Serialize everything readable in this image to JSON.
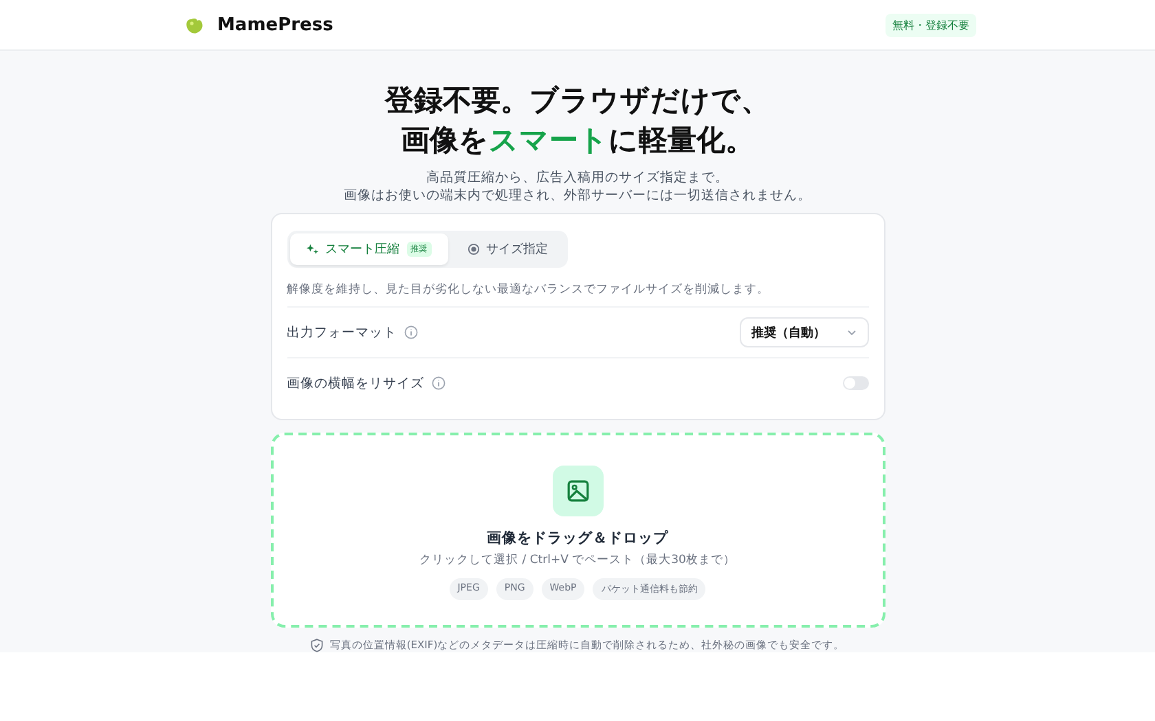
{
  "header": {
    "brand": "MamePress",
    "badge": "無料・登録不要"
  },
  "hero": {
    "line_1": "登録不要。ブラウザだけで、",
    "line_2": [
      {
        "text": "画像を",
        "highlight": false
      },
      {
        "text": "スマート",
        "highlight": true
      },
      {
        "text": "に軽量化。",
        "highlight": false
      }
    ],
    "subtitle": [
      "高品質圧縮から、広告入稿用のサイズ指定まで。",
      "画像はお使いの端末内で処理され、外部サーバーには一切送信されません。"
    ]
  },
  "settings": {
    "tabs": [
      {
        "label": "スマート圧縮",
        "badge": "推奨",
        "kind": "sparkle",
        "selected": true
      },
      {
        "label": "サイズ指定",
        "kind": "target",
        "selected": false
      }
    ],
    "description": "解像度を維持し、見た目が劣化しない最適なバランスでファイルサイズを削減します。",
    "rows": [
      {
        "label": "出力フォーマット",
        "kind": "select",
        "value": "推奨（自動）"
      },
      {
        "label": "画像の横幅をリサイズ",
        "kind": "toggle",
        "on": false
      }
    ]
  },
  "dropzone": {
    "title": "画像をドラッグ＆ドロップ",
    "subtitle": "クリックして選択 / Ctrl+V でペースト（最大30枚まで）",
    "chips": [
      "JPEG",
      "PNG",
      "WebP",
      "パケット通信料も節約"
    ]
  },
  "privacy_note": "写真の位置情報(EXIF)などのメタデータは圧縮時に自動で削除されるため、社外秘の画像でも安全です。"
}
